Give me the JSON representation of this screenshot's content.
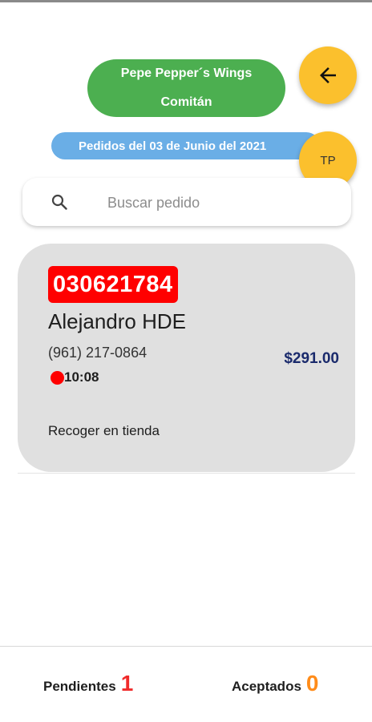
{
  "header": {
    "store_name": "Pepe Pepper´s Wings",
    "store_city": "Comitán",
    "date_label": "Pedidos del 03 de Junio del 2021",
    "back_icon": "arrow-left-icon",
    "user_initials": "TP"
  },
  "search": {
    "placeholder": "Buscar pedido",
    "value": "",
    "icon": "search-icon"
  },
  "orders": [
    {
      "id": "030621784",
      "customer": "Alejandro HDE",
      "phone": "(961) 217-0864",
      "time": "10:08",
      "total": "$291.00",
      "delivery": "Recoger en tienda",
      "status_color": "#ff0000"
    }
  ],
  "bottom_nav": {
    "pending_label": "Pendientes",
    "pending_count": "1",
    "accepted_label": "Aceptados",
    "accepted_count": "0"
  },
  "colors": {
    "store_pill": "#4caf50",
    "date_pill": "#6aaee6",
    "fab": "#fbc02d",
    "order_id_bg": "#ff0000",
    "total_text": "#1a2a6c",
    "pending_count": "#f02a2a",
    "accepted_count": "#ff8c1a"
  }
}
